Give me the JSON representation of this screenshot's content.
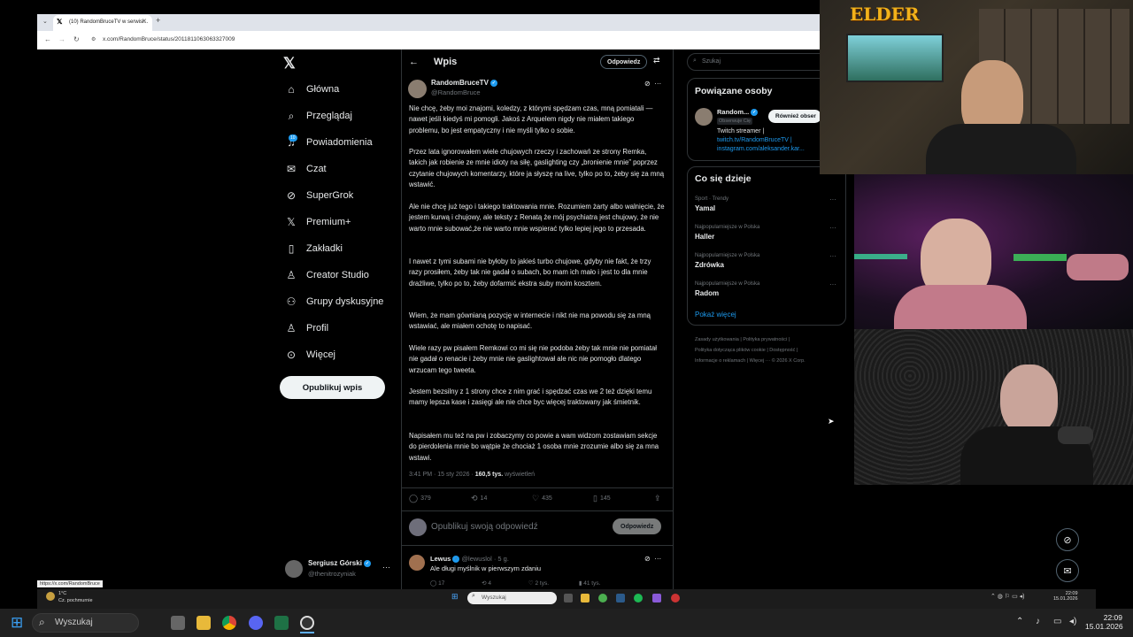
{
  "browser": {
    "tab_title": "(10) RandomBruceTV w serwisi...",
    "url": "x.com/RandomBruce/status/2011811063063327009",
    "status_url": "https://x.com/RandomBruce"
  },
  "nav": {
    "items": [
      {
        "label": "Główna",
        "icon": "home-icon"
      },
      {
        "label": "Przeglądaj",
        "icon": "search-icon"
      },
      {
        "label": "Powiadomienia",
        "icon": "bell-icon"
      },
      {
        "label": "Czat",
        "icon": "mail-icon"
      },
      {
        "label": "SuperGrok",
        "icon": "grok-icon"
      },
      {
        "label": "Premium+",
        "icon": "x-icon"
      },
      {
        "label": "Zakładki",
        "icon": "bookmark-icon"
      },
      {
        "label": "Creator Studio",
        "icon": "studio-icon"
      },
      {
        "label": "Grupy dyskusyjne",
        "icon": "groups-icon"
      },
      {
        "label": "Profil",
        "icon": "profile-icon"
      },
      {
        "label": "Więcej",
        "icon": "more-icon"
      }
    ],
    "notif_badge": "10",
    "post_button": "Opublikuj wpis",
    "account": {
      "name": "Sergiusz Górski",
      "handle": "@thenitrozyniak"
    }
  },
  "post": {
    "header_title": "Wpis",
    "header_reply": "Odpowiedz",
    "author": "RandomBruceTV",
    "handle": "@RandomBruce",
    "paragraphs": [
      "Nie chcę, żeby moi znajomi, koledzy, z którymi spędzam czas, mną pomiatali — nawet jeśli kiedyś mi pomogli. Jakoś z Arquelem nigdy nie miałem takiego problemu, bo jest empatyczny i nie myśli tylko o sobie.",
      "Przez lata ignorowałem wiele chujowych rzeczy i zachowań ze strony Remka, takich jak robienie ze mnie idioty na siłę, gaslighting czy „bronienie mnie” poprzez czytanie chujowych komentarzy, które ja słyszę na live, tylko po to, żeby się za mną wstawić.",
      "Ale nie chcę już tego i takiego traktowania mnie. Rozumiem żarty albo walnięcie, że jestem kurwą i chujowy, ale teksty z Renatą  że mój psychiatra jest chujowy, że nie warto mnie subować,że nie warto mnie wspierać tylko lepiej jego  to przesada.",
      "I nawet z tymi subami nie byłoby to jakieś turbo chujowe, gdyby nie fakt, że trzy razy prosiłem, żeby tak nie gadał o subach, bo mam ich mało i jest to dla mnie drażliwe, tylko po to, żeby dofarmić ekstra suby moim kosztem.",
      "Wiem, że mam gównianą pozycję w internecie i nikt nie ma powodu się za mną wstawiać, ale miałem ochotę to napisać.",
      "Wiele razy pw pisałem Remkowi co mi się nie podoba żeby tak mnie nie pomiatał nie gadał o renacie i żeby mnie nie gaslightował ale nic nie pomogło dlatego wrzucam tego tweeta.",
      "Jestem bezsilny z 1 strony chce z nim grać i spędzać czas we 2 też dzięki temu mamy lepsza kase i zasięgi ale nie chce byc więcej traktowany jak śmietnik.",
      "Napisałem mu też na pw i zobaczymy co powie a wam widzom zostawiam sekcje do pierdolenia mnie bo wątpie że chociaż 1 osoba mnie zrozumie albo się za mna wstawi."
    ],
    "time": "3:41 PM · 15 sty 2026 · ",
    "views": "160,5 tys.",
    "views_label": " wyświetleń",
    "stats": {
      "replies": "379",
      "reposts": "14",
      "likes": "435",
      "bookmarks": "145"
    },
    "reply_placeholder": "Opublikuj swoją odpowiedź",
    "reply_button": "Odpowiedz"
  },
  "reply": {
    "name": "Lewus",
    "handle_time": "@lewuslol · 5 g.",
    "text": "Ale długi myślnik w pierwszym zdaniu",
    "stats": {
      "replies": "17",
      "reposts": "4",
      "likes": "2 tys.",
      "views": "41 tys."
    }
  },
  "sidebar": {
    "search_placeholder": "Szukaj",
    "related_title": "Powiązane osoby",
    "related_name": "Random...",
    "related_follows": "Obserwuje Cię",
    "related_button": "Również obser",
    "related_bio_1": "Twitch streamer |",
    "related_bio_2": "twitch.tv/RandomBruceTV |",
    "related_bio_3": "instagram.com/aleksander.kar...",
    "trends_title": "Co się dzieje",
    "trends": [
      {
        "category": "Sport · Trendy",
        "name": "Yamal"
      },
      {
        "category": "Najpopularniejsze w Polska",
        "name": "Haller"
      },
      {
        "category": "Najpopularniejsze w Polska",
        "name": "Zdrówka"
      },
      {
        "category": "Najpopularniejsze w Polska",
        "name": "Radom"
      }
    ],
    "show_more": "Pokaż więcej",
    "footer_1": "Zasady użytkowania  |  Polityka prywatności  |",
    "footer_2": "Polityka dotycząca plików cookie  |  Dostępność  |",
    "footer_3": "Informacje o reklamach  |  Więcej ···  © 2026 X Corp."
  },
  "overlay": {
    "cam_logo": "ELDER"
  },
  "stream_bar": {
    "search": "Wyszukaj",
    "weather_temp": "1°C",
    "weather_text": "Cz. pochmurnie",
    "time": "22:09",
    "date": "15.01.2026"
  },
  "taskbar": {
    "search": "Wyszukaj",
    "time": "22:09",
    "date": "15.01.2026"
  },
  "colors": {
    "accent": "#1d9bf0",
    "bg": "#000000",
    "text": "#e7e9ea",
    "muted": "#71767b"
  }
}
